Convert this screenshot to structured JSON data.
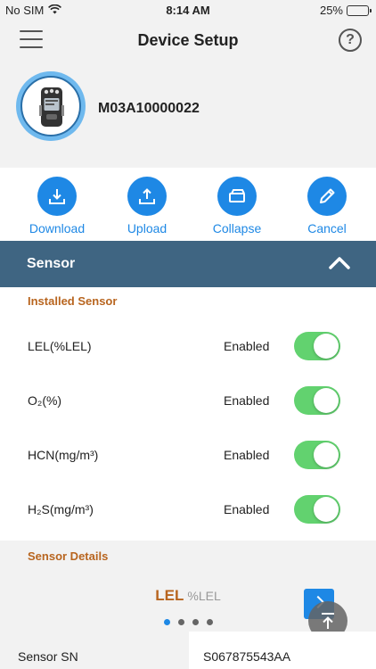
{
  "status": {
    "carrier": "No SIM",
    "time": "8:14 AM",
    "battery": "25%",
    "battery_level": 0.25
  },
  "nav": {
    "title": "Device Setup",
    "help": "?"
  },
  "device": {
    "serial": "M03A10000022"
  },
  "actions": [
    {
      "label": "Download",
      "icon": "download-icon"
    },
    {
      "label": "Upload",
      "icon": "upload-icon"
    },
    {
      "label": "Collapse",
      "icon": "collapse-icon"
    },
    {
      "label": "Cancel",
      "icon": "pencil-icon"
    }
  ],
  "section": {
    "title": "Sensor"
  },
  "installed": {
    "title": "Installed Sensor",
    "sensors": [
      {
        "name": "LEL(%LEL)",
        "status": "Enabled",
        "on": true
      },
      {
        "name": "O₂(%)",
        "status": "Enabled",
        "on": true
      },
      {
        "name": "HCN(mg/m³)",
        "status": "Enabled",
        "on": true
      },
      {
        "name": "H₂S(mg/m³)",
        "status": "Enabled",
        "on": true
      }
    ]
  },
  "details": {
    "title": "Sensor Details",
    "current": {
      "name": "LEL",
      "unit": "%LEL"
    },
    "page_index": 0,
    "page_count": 4,
    "sn_label": "Sensor SN",
    "sn_value": "S067875543AA"
  },
  "colors": {
    "accent": "#1e88e5",
    "header": "#3f6582",
    "toggle_on": "#62d26f",
    "subtitle": "#b8651f"
  }
}
